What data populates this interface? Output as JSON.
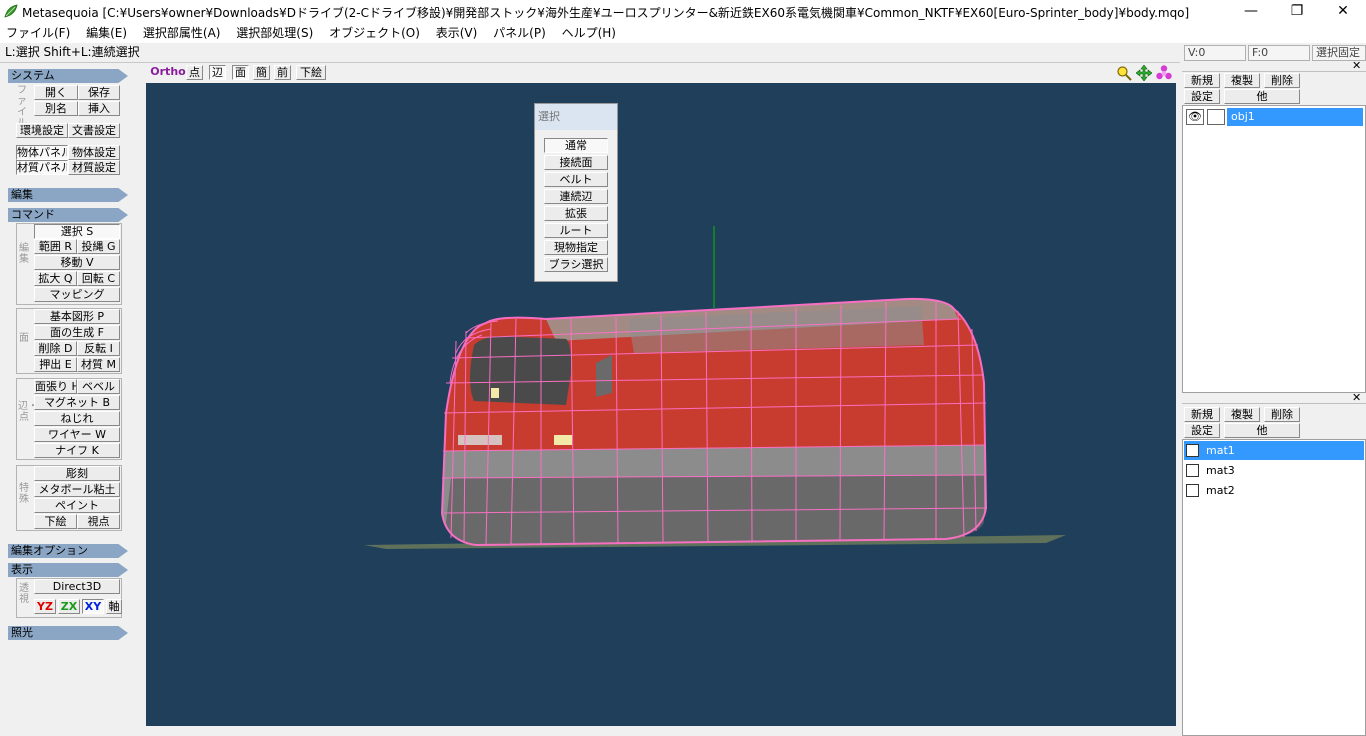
{
  "window": {
    "title": "Metasequoia [C:¥Users¥owner¥Downloads¥Dドライブ(2-Cドライブ移設)¥開発部ストック¥海外生産¥ユーロスプリンター&新近鉄EX60系電気機関車¥Common_NKTF¥EX60[Euro-Sprinter_body]¥body.mqo]",
    "minimize": "—",
    "maximize": "❐",
    "close": "✕"
  },
  "menu": [
    "ファイル(F)",
    "編集(E)",
    "選択部属性(A)",
    "選択部処理(S)",
    "オブジェクト(O)",
    "表示(V)",
    "パネル(P)",
    "ヘルプ(H)"
  ],
  "status_text": "L:選択  Shift+L:連続選択",
  "left": {
    "system": {
      "header": "システム",
      "file_label": "ファイル",
      "open": "開く",
      "save": "保存",
      "save_as": "別名",
      "insert": "挿入",
      "env": "環境設定",
      "doc": "文書設定",
      "obj_panel": "物体パネル",
      "obj_settings": "物体設定",
      "mat_panel": "材質パネル",
      "mat_settings": "材質設定"
    },
    "edit_header": "編集",
    "command": {
      "header": "コマンド",
      "edit_label": "編集",
      "select": "選択 S",
      "range": "範囲 R",
      "lasso": "投縄 G",
      "move": "移動 V",
      "scale": "拡大 Q",
      "rotate": "回転 C",
      "mapping": "マッピング",
      "face_label": "面",
      "primitive": "基本図形 P",
      "face_gen": "面の生成 F",
      "delete": "削除 D",
      "invert": "反転 I",
      "extrude": "押出 E",
      "material": "材質 M",
      "edge_label": "辺・点",
      "stretch": "面張り H",
      "bevel": "ベベル",
      "magnet": "マグネット B",
      "twist": "ねじれ",
      "wire": "ワイヤー W",
      "knife": "ナイフ K",
      "special_label": "特殊",
      "sculpt": "彫刻",
      "metaball": "メタボール粘土",
      "paint": "ペイント",
      "underlay": "下絵",
      "viewpoint": "視点"
    },
    "edit_options_header": "編集オプション",
    "display": {
      "header": "表示",
      "persp_label": "透視",
      "renderer": "Direct3D",
      "yz": "YZ",
      "zx": "ZX",
      "xy": "XY",
      "axis": "軸"
    },
    "lighting_header": "照光"
  },
  "viewport_toolbar": {
    "ortho": "Ortho",
    "point": "点",
    "edge": "辺",
    "face": "面",
    "simple": "簡",
    "front": "前",
    "underlay": "下絵"
  },
  "select_dialog": {
    "caption": "選択",
    "items": [
      "通常",
      "接続面",
      "ベルト",
      "連続辺",
      "拡張",
      "ルート",
      "現物指定",
      "ブラシ選択"
    ]
  },
  "right": {
    "v_count": "V:0",
    "f_count": "F:0",
    "lock_select": "選択固定",
    "object_panel": {
      "new": "新規",
      "duplicate": "複製",
      "delete": "削除",
      "settings": "設定",
      "other": "他",
      "items": [
        "obj1"
      ]
    },
    "material_panel": {
      "new": "新規",
      "duplicate": "複製",
      "delete": "削除",
      "settings": "設定",
      "other": "他",
      "items": [
        "mat1",
        "mat3",
        "mat2"
      ]
    }
  },
  "colors": {
    "viewport_bg": "#1f3f5a",
    "wireframe": "#ff70c8",
    "body_red": "#c83c30",
    "selection": "#3399ff"
  }
}
